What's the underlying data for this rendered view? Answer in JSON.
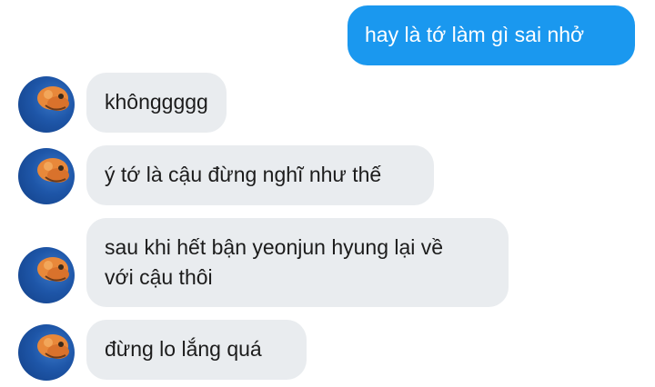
{
  "conversation": {
    "outgoing": [
      {
        "text": "hay là tớ làm gì sai nhở"
      }
    ],
    "incoming": [
      {
        "text": "khônggggg",
        "avatar_icon": "profile-avatar-icon"
      },
      {
        "text": "ý tớ là cậu đừng nghĩ như thế",
        "avatar_icon": "profile-avatar-icon"
      },
      {
        "text": "sau khi hết bận yeonjun hyung lại về",
        "text_line2": "với cậu thôi",
        "avatar_icon": "profile-avatar-icon"
      },
      {
        "text": "đừng lo lắng quá",
        "avatar_icon": "profile-avatar-icon"
      }
    ]
  },
  "colors": {
    "outgoing_bubble": "#1a98ef",
    "incoming_bubble": "#e9ecef",
    "background": "#ffffff"
  }
}
